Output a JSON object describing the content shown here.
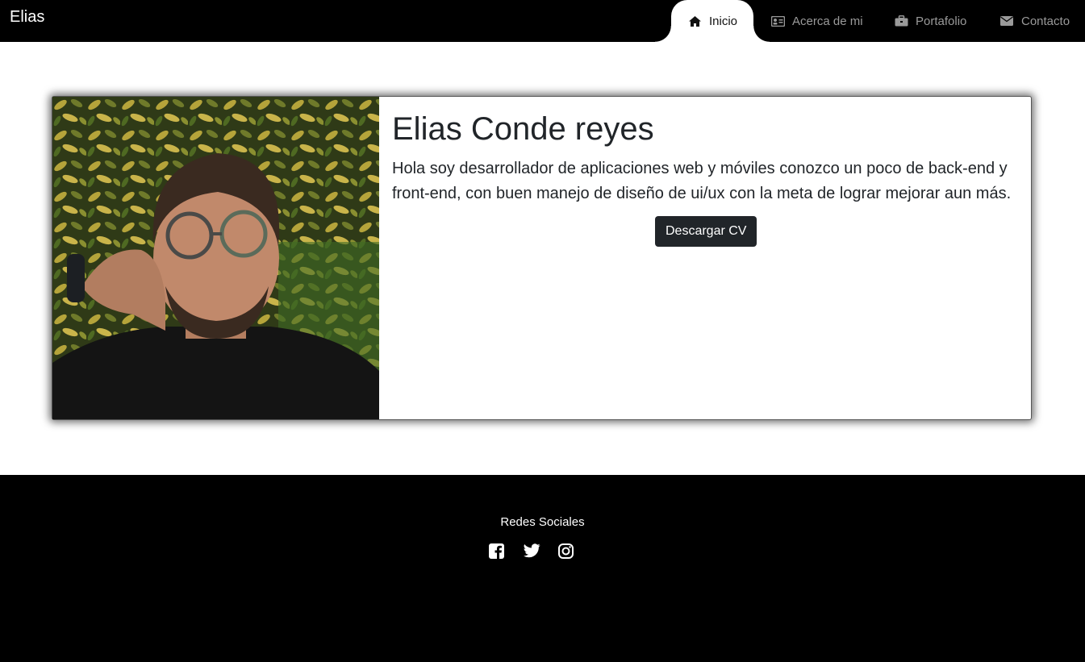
{
  "nav": {
    "brand": "Elias",
    "items": [
      {
        "label": "Inicio",
        "icon": "home-icon",
        "active": true
      },
      {
        "label": "Acerca de mi",
        "icon": "id-card-icon",
        "active": false
      },
      {
        "label": "Portafolio",
        "icon": "briefcase-icon",
        "active": false
      },
      {
        "label": "Contacto",
        "icon": "envelope-icon",
        "active": false
      }
    ]
  },
  "profile": {
    "name": "Elias Conde reyes",
    "bio": "Hola soy desarrollador de aplicaciones web y móviles conozco un poco de back-end y front-end, con buen manejo de diseño de ui/ux con la meta de lograr mejorar aun más.",
    "cv_button": "Descargar CV",
    "photo": "profile-photo"
  },
  "footer": {
    "title": "Redes Sociales",
    "socials": [
      "facebook-icon",
      "twitter-icon",
      "instagram-icon"
    ]
  },
  "colors": {
    "nav_bg": "#000000",
    "button_bg": "#212529",
    "text": "#212529",
    "nav_inactive": "#9a9a9a"
  }
}
